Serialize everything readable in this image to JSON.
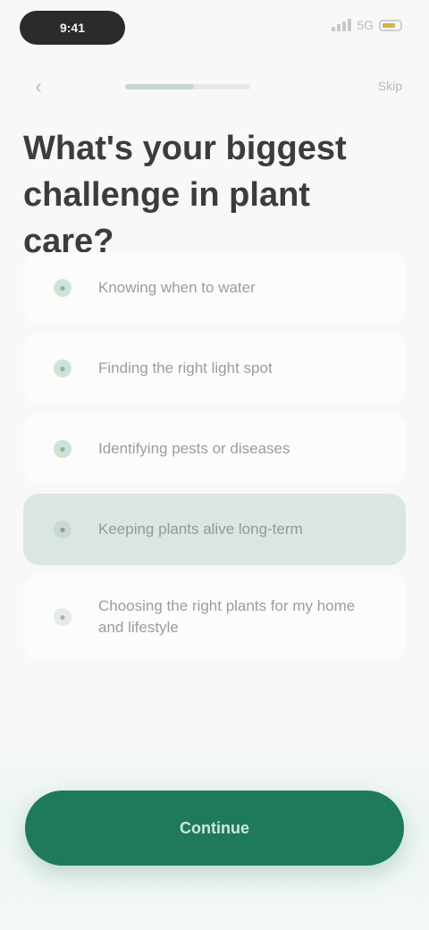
{
  "status_bar": {
    "time": "9:41",
    "network": "5G"
  },
  "nav": {
    "back_icon": "chevron-left-icon",
    "progress_fraction": 0.55,
    "step_label": "Skip"
  },
  "question": {
    "title": "What's your biggest challenge in plant care?"
  },
  "options": [
    {
      "label": "Knowing when to water",
      "icon": "droplet-icon",
      "selected": false
    },
    {
      "label": "Finding the right light spot",
      "icon": "sun-icon",
      "selected": false
    },
    {
      "label": "Identifying pests or diseases",
      "icon": "bug-icon",
      "selected": false
    },
    {
      "label": "Keeping plants alive long-term",
      "icon": "leaf-icon",
      "selected": true
    },
    {
      "label": "Choosing the right plants for my home and lifestyle",
      "icon": "home-icon",
      "selected": false
    }
  ],
  "footer": {
    "continue_label": "Continue"
  },
  "colors": {
    "accent": "#1f7a5c",
    "selected_bg": "#dbe6e2"
  }
}
